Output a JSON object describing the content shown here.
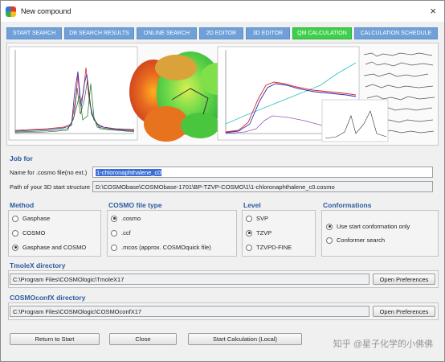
{
  "window": {
    "title": "New compound",
    "close": "×"
  },
  "tabs": [
    {
      "label": "START SEARCH",
      "active": false
    },
    {
      "label": "DB SEARCH RESULTS",
      "active": false
    },
    {
      "label": "ONLINE SEARCH",
      "active": false
    },
    {
      "label": "2D EDITOR",
      "active": false
    },
    {
      "label": "3D EDITOR",
      "active": false
    },
    {
      "label": "QM CALCULATION",
      "active": true
    },
    {
      "label": "CALCULATION SCHEDULE",
      "active": false
    }
  ],
  "job": {
    "heading": "Job for",
    "cosmo_label": "Name for .cosmo file(no ext.)",
    "cosmo_value": "1-chloronaphthalene_c0",
    "path_label": "Path of your 3D start structure",
    "path_value": "D:\\COSMObase\\COSMObase-1701\\BP-TZVP-COSMO\\1\\1-chloronaphthalene_c0.cosmo"
  },
  "method": {
    "heading": "Method",
    "options": [
      {
        "label": "Gasphase",
        "selected": false
      },
      {
        "label": "COSMO",
        "selected": false
      },
      {
        "label": "Gasphase and COSMO",
        "selected": true
      }
    ]
  },
  "filetype": {
    "heading": "COSMO file type",
    "options": [
      {
        "label": ".cosmo",
        "selected": true
      },
      {
        "label": ".ccf",
        "selected": false
      },
      {
        "label": ".mcos (approx. COSMOquick file)",
        "selected": false
      }
    ]
  },
  "level": {
    "heading": "Level",
    "options": [
      {
        "label": "SVP",
        "selected": false
      },
      {
        "label": "TZVP",
        "selected": true
      },
      {
        "label": "TZVPD-FINE",
        "selected": false
      }
    ]
  },
  "conformations": {
    "heading": "Conformations",
    "options": [
      {
        "label": "Use start conformation only",
        "selected": true
      },
      {
        "label": "Conformer search",
        "selected": false
      }
    ]
  },
  "tmolex": {
    "heading": "TmoleX directory",
    "path": "C:\\Program Files\\COSMOlogic\\TmoleX17",
    "button": "Open Preferences"
  },
  "cosmoconf": {
    "heading": "COSMOconfX directory",
    "path": "C:\\Program Files\\COSMOlogic\\COSMOconfX17",
    "button": "Open Preferences"
  },
  "footer": {
    "return_button": "Return to Start",
    "close_button": "Close",
    "start_button": "Start Calculation (Local)",
    "watermark": "知乎 @星子化学的小佛佛"
  }
}
